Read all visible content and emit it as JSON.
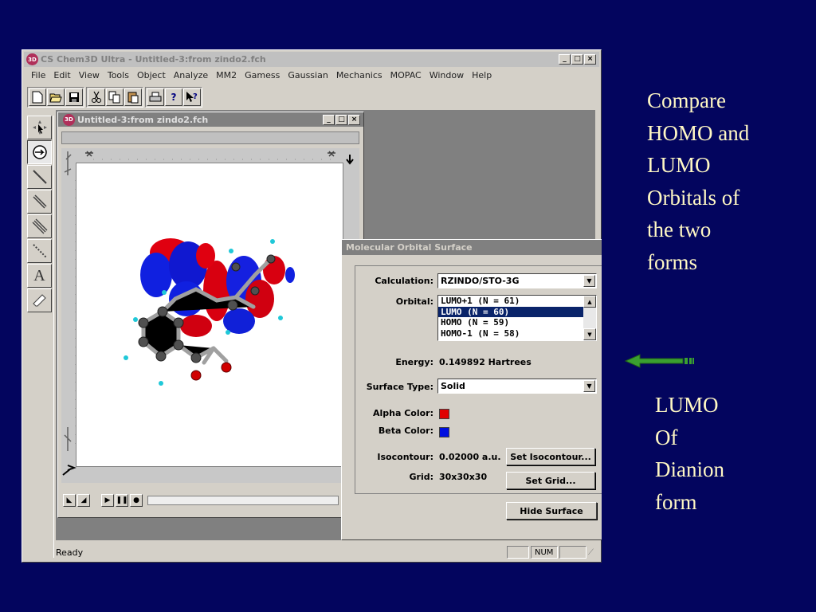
{
  "app": {
    "title": "CS Chem3D Ultra - Untitled-3:from zindo2.fch",
    "icon": "3D",
    "window_controls": [
      "_",
      "□",
      "×"
    ],
    "menus": [
      "File",
      "Edit",
      "View",
      "Tools",
      "Object",
      "Analyze",
      "MM2",
      "Gamess",
      "Gaussian",
      "Mechanics",
      "MOPAC",
      "Window",
      "Help"
    ],
    "toolbar_icons": [
      "new-icon",
      "open-icon",
      "save-icon",
      "cut-icon",
      "copy-icon",
      "paste-icon",
      "print-icon",
      "help-icon",
      "context-help-icon"
    ],
    "palette_icons": [
      "select-tool-icon",
      "rotate-tool-icon",
      "single-bond-icon",
      "double-bond-icon",
      "triple-bond-icon",
      "dashed-bond-icon",
      "text-tool-icon",
      "eraser-icon"
    ],
    "text_tool_glyph": "A",
    "status": {
      "text": "Ready",
      "num": "NUM"
    }
  },
  "child": {
    "title": "Untitled-3:from zindo2.fch",
    "icon": "3D"
  },
  "dialog": {
    "title": "Molecular Orbital Surface",
    "calculation_label": "Calculation:",
    "calculation_value": "RZINDO/STO-3G",
    "orbital_label": "Orbital:",
    "orbitals": [
      "LUMO+1 (N =  61)",
      "LUMO (N =  60)",
      "HOMO (N =  59)",
      "HOMO-1 (N =  58)"
    ],
    "selected_orbital_index": 1,
    "energy_label": "Energy:",
    "energy_value": "0.149892 Hartrees",
    "surface_type_label": "Surface Type:",
    "surface_type_value": "Solid",
    "alpha_label": "Alpha Color:",
    "alpha_color": "#e00000",
    "beta_label": "Beta Color:",
    "beta_color": "#0010e0",
    "isocontour_label": "Isocontour:",
    "isocontour_value": "0.02000 a.u.",
    "set_isocontour_button": "Set Isocontour...",
    "grid_label": "Grid:",
    "grid_value": "30x30x30",
    "set_grid_button": "Set Grid...",
    "hide_surface_button": "Hide Surface"
  },
  "slide": {
    "heading_lines": [
      "Compare",
      "HOMO and",
      "LUMO",
      "Orbitals of",
      "the two",
      "forms"
    ],
    "caption_lines": [
      "LUMO",
      "Of",
      "Dianion",
      "form"
    ],
    "text_color": "#fff8c4",
    "arrow_color": "#3aa030"
  }
}
